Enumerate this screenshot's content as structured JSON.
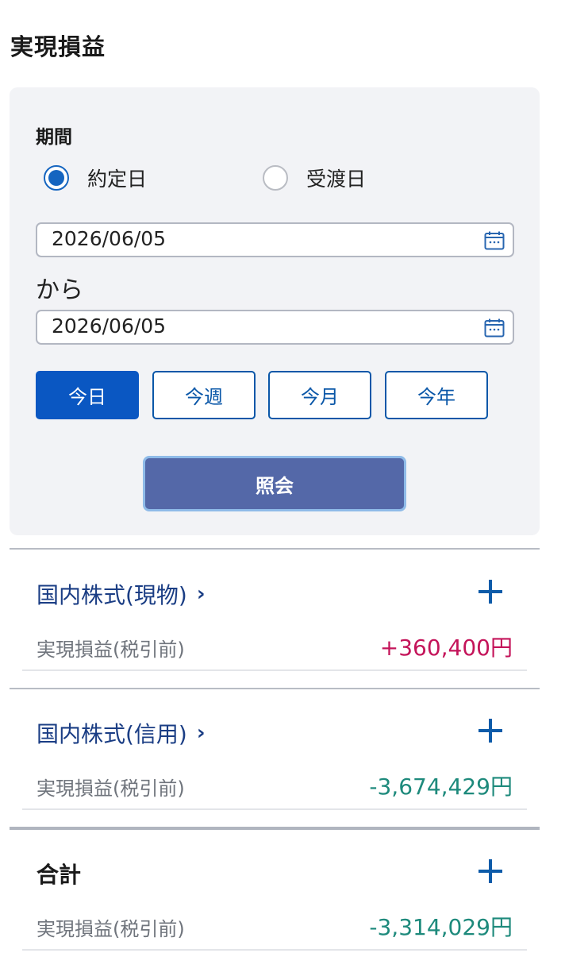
{
  "page": {
    "title": "実現損益"
  },
  "filter": {
    "period_label": "期間",
    "radio_options": [
      {
        "label": "約定日",
        "checked": true
      },
      {
        "label": "受渡日",
        "checked": false
      }
    ],
    "from_date": "2026/06/05",
    "from_suffix": "から",
    "to_date": "2026/06/05",
    "quick_buttons": [
      {
        "label": "今日",
        "active": true
      },
      {
        "label": "今週",
        "active": false
      },
      {
        "label": "今月",
        "active": false
      },
      {
        "label": "今年",
        "active": false
      }
    ],
    "submit_label": "照会"
  },
  "sections": [
    {
      "title": "国内株式(現物)",
      "chevron": "›",
      "pl_label": "実現損益(税引前)",
      "pl_value": "+360,400円",
      "value_color": "#c4145a"
    },
    {
      "title": "国内株式(信用)",
      "chevron": "›",
      "pl_label": "実現損益(税引前)",
      "pl_value": "-3,674,429円",
      "value_color": "#1e8a7c"
    },
    {
      "title": "合計",
      "pl_label": "実現損益(税引前)",
      "pl_value": "-3,314,029円",
      "value_color": "#1e8a7c"
    }
  ],
  "icons": {
    "calendar": "calendar-icon",
    "expand": "plus-icon",
    "navigate": "chevron-right-icon"
  },
  "colors": {
    "accent": "#0a57c2",
    "submit_bg": "#5468a8",
    "positive": "#c4145a",
    "negative": "#1e8a7c",
    "link": "#1a3d84"
  }
}
